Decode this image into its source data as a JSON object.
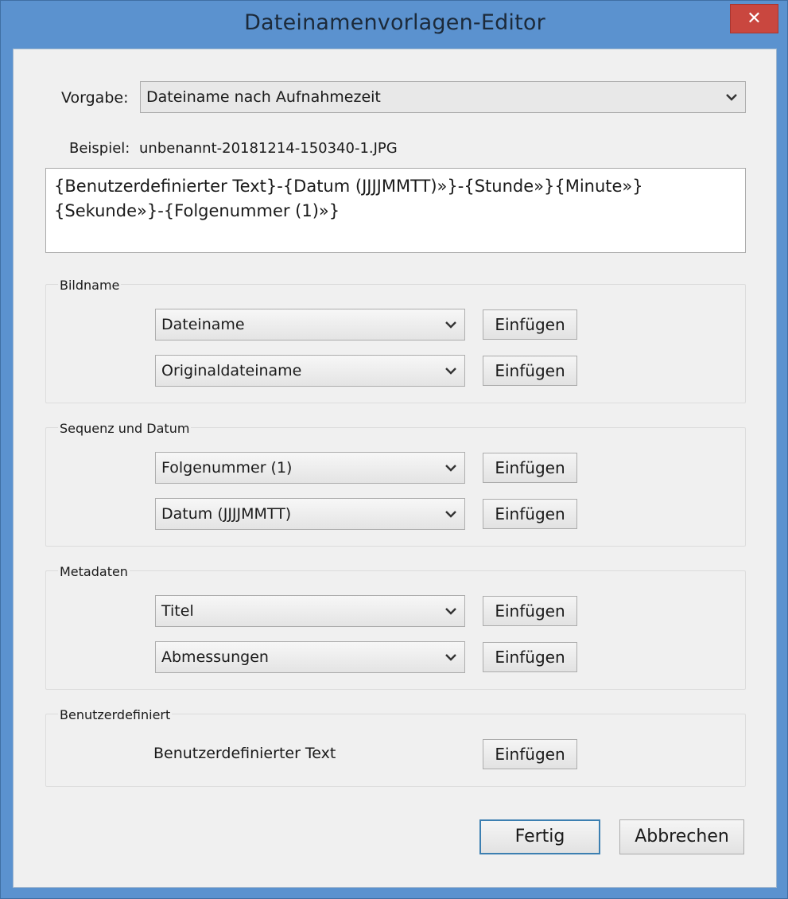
{
  "window": {
    "title": "Dateinamenvorlagen-Editor",
    "close_glyph": "✕"
  },
  "preset": {
    "label": "Vorgabe:",
    "value": "Dateiname nach Aufnahmezeit"
  },
  "example": {
    "label": "Beispiel:",
    "value": "unbenannt-20181214-150340-1.JPG"
  },
  "template": {
    "line1": "{Benutzerdefinierter Text}-{Datum (JJJJMMTT)»}-{Stunde»}{Minute»}",
    "line2": "{Sekunde»}-{Folgenummer (1)»}"
  },
  "groups": {
    "image_name": {
      "title": "Bildname",
      "select1": "Dateiname",
      "select2": "Originaldateiname",
      "insert1": "Einfügen",
      "insert2": "Einfügen"
    },
    "sequence_date": {
      "title": "Sequenz und Datum",
      "select1": "Folgenummer (1)",
      "select2": "Datum (JJJJMMTT)",
      "insert1": "Einfügen",
      "insert2": "Einfügen"
    },
    "metadata": {
      "title": "Metadaten",
      "select1": "Titel",
      "select2": "Abmessungen",
      "insert1": "Einfügen",
      "insert2": "Einfügen"
    },
    "custom": {
      "title": "Benutzerdefiniert",
      "label": "Benutzerdefinierter Text",
      "insert": "Einfügen"
    }
  },
  "footer": {
    "done": "Fertig",
    "cancel": "Abbrechen"
  },
  "icons": {
    "dropdown": "chevron-down-icon",
    "close": "close-icon"
  },
  "colors": {
    "title_bar": "#5b92cf",
    "close_button": "#c9473f",
    "default_button_border": "#3c7fb1"
  }
}
